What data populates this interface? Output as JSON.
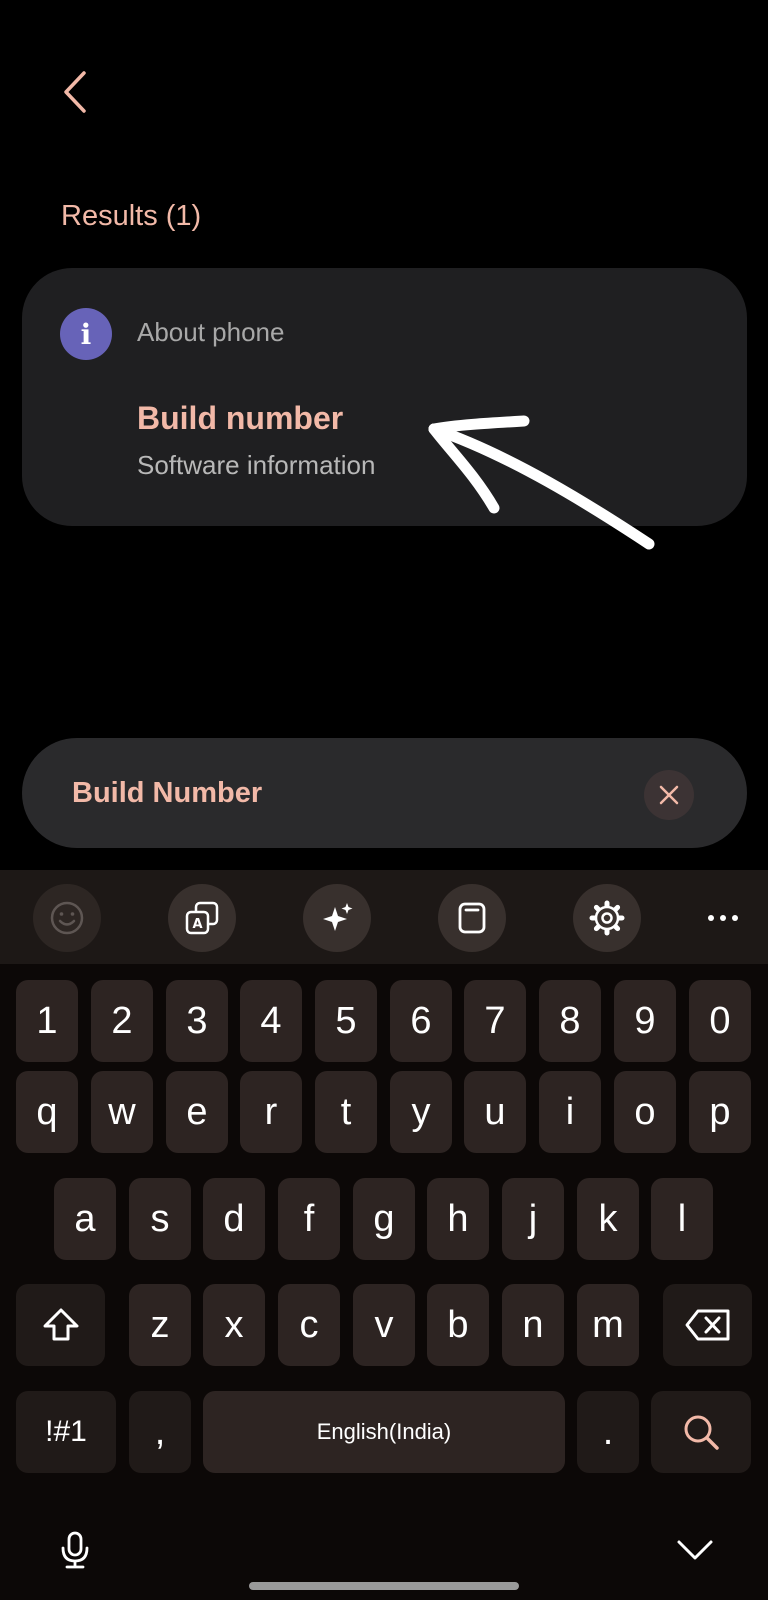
{
  "header": {
    "back_icon": "chevron-left-icon"
  },
  "results": {
    "heading": "Results (1)",
    "card": {
      "category_icon": "info-icon",
      "icon_glyph": "i",
      "category": "About phone",
      "item_title": "Build number",
      "item_subtitle": "Software information"
    }
  },
  "search": {
    "value": "Build Number",
    "clear_icon": "close-icon"
  },
  "keyboard_toolbar": {
    "buttons": [
      "emoji-icon",
      "translate-icon",
      "ai-sparkle-icon",
      "clipboard-icon",
      "gear-icon",
      "more-icon"
    ]
  },
  "keyboard": {
    "number_row": [
      "1",
      "2",
      "3",
      "4",
      "5",
      "6",
      "7",
      "8",
      "9",
      "0"
    ],
    "row1": [
      "q",
      "w",
      "e",
      "r",
      "t",
      "y",
      "u",
      "i",
      "o",
      "p"
    ],
    "row2": [
      "a",
      "s",
      "d",
      "f",
      "g",
      "h",
      "j",
      "k",
      "l"
    ],
    "row3": [
      "z",
      "x",
      "c",
      "v",
      "b",
      "n",
      "m"
    ],
    "bottom": {
      "symbols": "!#1",
      "comma": ",",
      "space": "English(India)",
      "period": "."
    },
    "shift_icon": "shift-icon",
    "backspace_icon": "backspace-icon",
    "search_icon": "search-icon"
  },
  "colors": {
    "accent": "#f2b9a8",
    "card": "#1f1f21",
    "key": "#2d2422",
    "info_icon": "#6763b8"
  }
}
